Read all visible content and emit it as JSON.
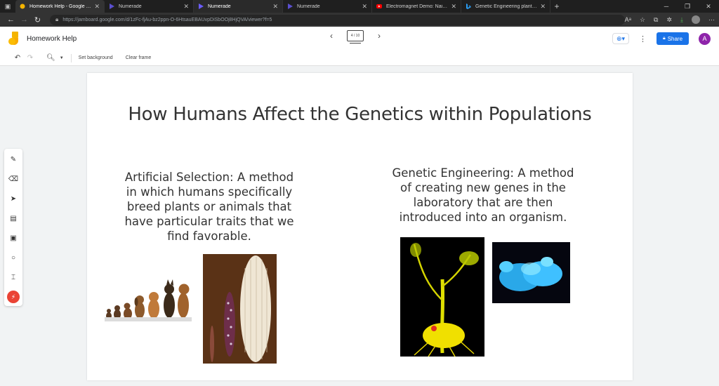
{
  "browser": {
    "tabs": [
      {
        "label": "Homework Help - Google Jamboard",
        "active": true
      },
      {
        "label": "Numerade",
        "active": false
      },
      {
        "label": "Numerade",
        "active": false
      },
      {
        "label": "Numerade",
        "active": false
      },
      {
        "label": "Electromagnet Demo: Nail - YouTube",
        "active": false
      },
      {
        "label": "Genetic Engineering plants - Bing",
        "active": false
      }
    ],
    "url": "https://jamboard.google.com/d/1zFc-fjAu-bz2ppn-O-6HtsauEBAUvpDiSbOOj8HjQVA/viewer?f=5"
  },
  "app": {
    "title": "Homework Help",
    "frame_counter": "4 / 10",
    "share_label": "Share",
    "avatar_letter": "A",
    "accent": "#1a73e8"
  },
  "toolbar": {
    "set_background": "Set background",
    "clear_frame": "Clear frame"
  },
  "tools": [
    "pen-icon",
    "eraser-icon",
    "select-icon",
    "sticky-note-icon",
    "image-icon",
    "circle-icon",
    "text-box-icon",
    "laser-icon"
  ],
  "slide": {
    "title": "How Humans Affect the Genetics within Populations",
    "left_text": "Artificial Selection:  A method in which humans specifically breed plants or animals that have particular traits that we find favorable.",
    "right_text": "Genetic Engineering:  A method of creating new genes in the laboratory that are then introduced into an organism."
  }
}
